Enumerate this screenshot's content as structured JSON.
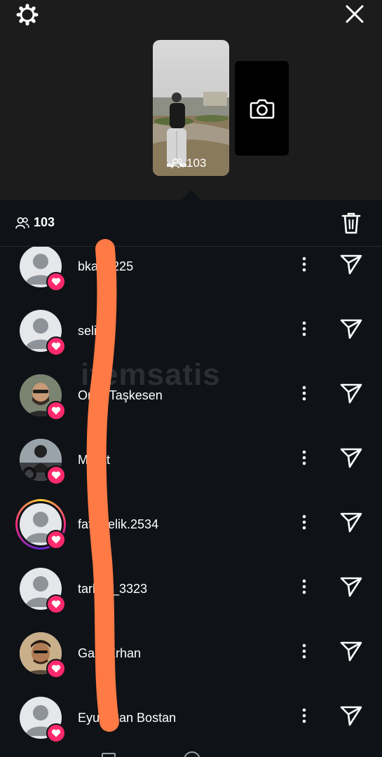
{
  "header": {
    "viewer_count_overlay": "103"
  },
  "viewers_bar": {
    "count": "103"
  },
  "viewers": [
    {
      "name": "bkaan225",
      "has_ring": false,
      "avatar_type": "default"
    },
    {
      "name": "selim",
      "has_ring": false,
      "avatar_type": "default"
    },
    {
      "name": "Onur Taşkesen",
      "has_ring": false,
      "avatar_type": "photo"
    },
    {
      "name": "Murat",
      "has_ring": false,
      "avatar_type": "photo"
    },
    {
      "name": "fatihcelik.2534",
      "has_ring": true,
      "avatar_type": "default"
    },
    {
      "name": "tarkus_3323",
      "has_ring": false,
      "avatar_type": "default"
    },
    {
      "name": "Gazi Erhan",
      "has_ring": false,
      "avatar_type": "photo"
    },
    {
      "name": "Eyup Can Bostan",
      "has_ring": false,
      "avatar_type": "default"
    }
  ],
  "watermark": "itemsatis",
  "colors": {
    "background": "#0f1217",
    "header_bg": "#1c1c1c",
    "like_badge": "#ff2a6d",
    "censor_stroke": "#ff7a45"
  }
}
